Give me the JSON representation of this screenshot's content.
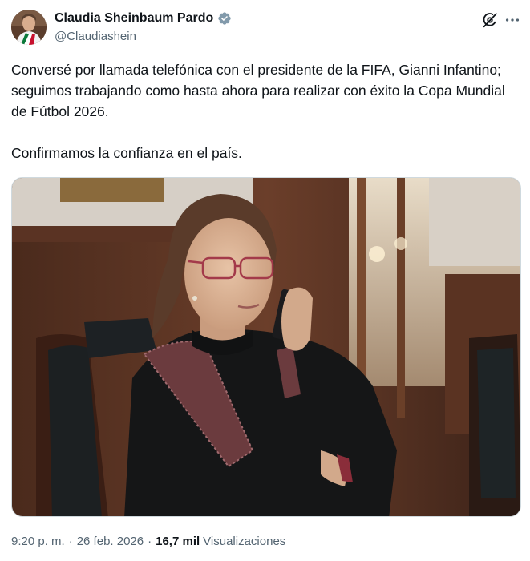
{
  "author": {
    "display_name": "Claudia Sheinbaum Pardo",
    "handle": "@Claudiashein",
    "verified": true,
    "verified_color": "#829aab"
  },
  "icons": {
    "avatar": "profile-photo",
    "verified": "verified-badge-icon",
    "grok": "grok-icon",
    "more": "more-options-icon"
  },
  "tweet": {
    "text": "Conversé por llamada telefónica con el presidente de la FIFA, Gianni Infantino; seguimos trabajando como hasta ahora para realizar con éxito la Copa Mundial de Fútbol 2026.\n\nConfirmamos la confianza en el país."
  },
  "media": {
    "type": "photo"
  },
  "meta": {
    "time": "9:20 p. m.",
    "separator": "·",
    "date": "26 feb. 2026",
    "views_count": "16,7 mil",
    "views_label": "Visualizaciones"
  }
}
